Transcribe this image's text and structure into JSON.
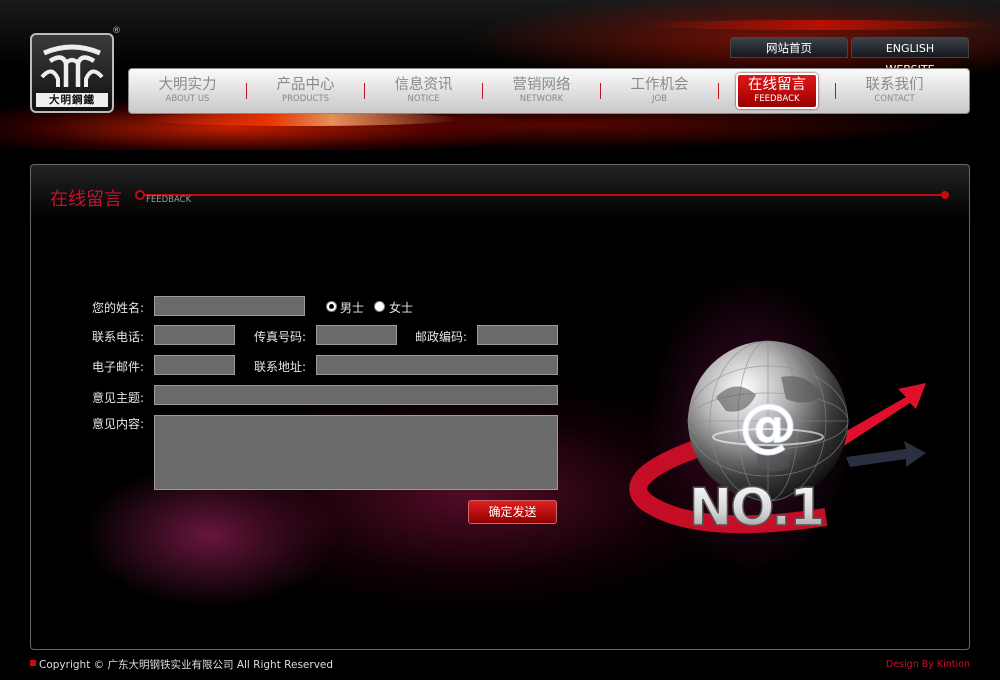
{
  "brand": {
    "logo_text": "大明鋼鐵",
    "reg_mark": "®"
  },
  "top_links": {
    "home": "网站首页",
    "english": "ENGLISH WEBSITE"
  },
  "nav": {
    "items": [
      {
        "cn": "大明实力",
        "en": "ABOUT US"
      },
      {
        "cn": "产品中心",
        "en": "PRODUCTS"
      },
      {
        "cn": "信息资讯",
        "en": "NOTICE"
      },
      {
        "cn": "营销网络",
        "en": "NETWORK"
      },
      {
        "cn": "工作机会",
        "en": "JOB"
      },
      {
        "cn": "在线留言",
        "en": "FEEDBACK"
      },
      {
        "cn": "联系我们",
        "en": "CONTACT"
      }
    ],
    "active_index": 5
  },
  "section": {
    "title": "在线留言",
    "subtitle": "FEEDBACK"
  },
  "form": {
    "name_label": "您的姓名:",
    "gender_male": "男士",
    "gender_female": "女士",
    "gender_selected": "男士",
    "phone_label": "联系电话:",
    "fax_label": "传真号码:",
    "zip_label": "邮政编码:",
    "email_label": "电子邮件:",
    "address_label": "联系地址:",
    "subject_label": "意见主题:",
    "content_label": "意见内容:",
    "submit_label": "确定发送",
    "name_value": "",
    "phone_value": "",
    "fax_value": "",
    "zip_value": "",
    "email_value": "",
    "address_value": "",
    "subject_value": "",
    "content_value": ""
  },
  "art": {
    "badge_text": "NO.1",
    "symbol": "@"
  },
  "footer": {
    "copyright": "Copyright © 广东大明钢铁实业有限公司 All Right Reserved",
    "design": "Design By Kintion"
  },
  "colors": {
    "accent_red": "#c8102e",
    "panel_border": "#666666",
    "field_bg": "#6a6a6a"
  }
}
